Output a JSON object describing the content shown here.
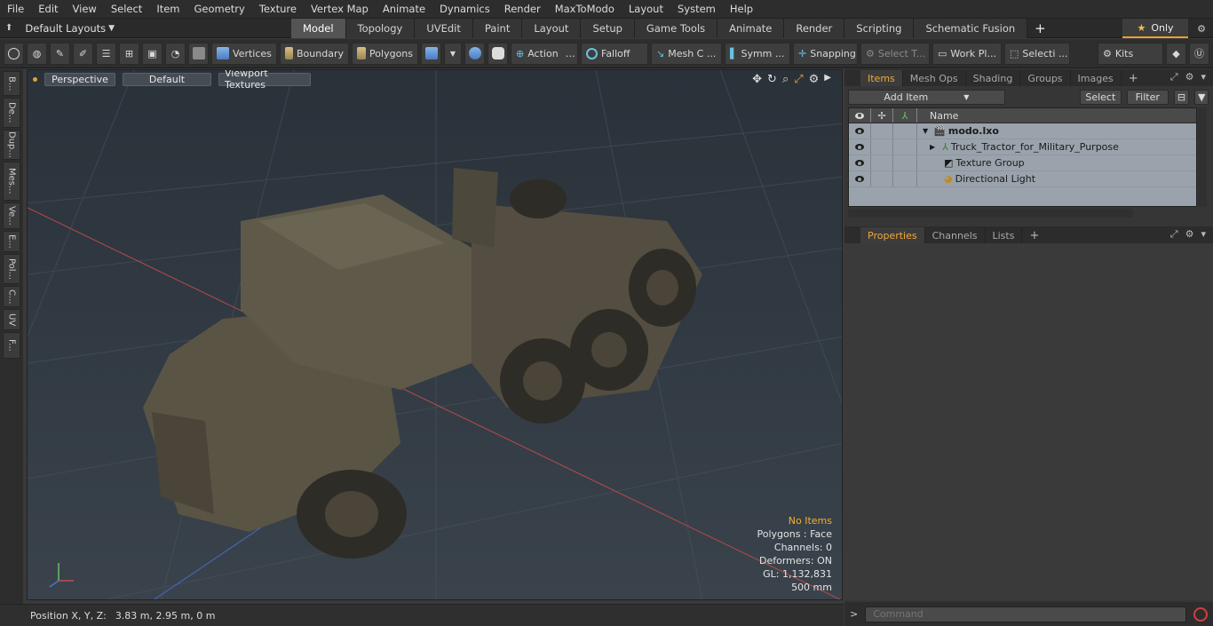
{
  "menu": [
    "File",
    "Edit",
    "View",
    "Select",
    "Item",
    "Geometry",
    "Texture",
    "Vertex Map",
    "Animate",
    "Dynamics",
    "Render",
    "MaxToModo",
    "Layout",
    "System",
    "Help"
  ],
  "layouts_label": "Default Layouts",
  "layout_tabs": [
    "Model",
    "Topology",
    "UVEdit",
    "Paint",
    "Layout",
    "Setup",
    "Game Tools",
    "Animate",
    "Render",
    "Scripting",
    "Schematic Fusion"
  ],
  "active_tab": "Model",
  "only_label": "Only",
  "toolbar": {
    "vertices": "Vertices",
    "boundary": "Boundary",
    "polygons": "Polygons",
    "action": "Action",
    "falloff": "Falloff",
    "meshc": "Mesh C ...",
    "symm": "Symm ...",
    "snapping": "Snapping",
    "selectt": "Select T...",
    "workpl": "Work Pl...",
    "selecti": "Selecti ...",
    "kits": "Kits"
  },
  "left_tabs": [
    "B...",
    "De...",
    "Dup...",
    "Mes...",
    "Ve...",
    "E...",
    "Pol...",
    "C...",
    "UV",
    "F..."
  ],
  "viewport": {
    "perspective": "Perspective",
    "default": "Default",
    "textures": "Viewport Textures",
    "info": {
      "no_items": "No Items",
      "polygons": "Polygons : Face",
      "channels": "Channels: 0",
      "deformers": "Deformers: ON",
      "gl": "GL: 1,132,831",
      "scale": "500 mm"
    }
  },
  "status": {
    "label": "Position X, Y, Z:",
    "value": "3.83 m, 2.95 m, 0 m"
  },
  "items_panel": {
    "tabs": [
      "Items",
      "Mesh Ops",
      "Shading",
      "Groups",
      "Images"
    ],
    "add_item": "Add Item",
    "select": "Select",
    "filter": "Filter",
    "name_header": "Name",
    "rows": [
      {
        "name": "modo.lxo"
      },
      {
        "name": "Truck_Tractor_for_Military_Purpose"
      },
      {
        "name": "Texture Group"
      },
      {
        "name": "Directional Light"
      }
    ]
  },
  "props_panel": {
    "tabs": [
      "Properties",
      "Channels",
      "Lists"
    ]
  },
  "command": {
    "placeholder": "Command"
  },
  "colors": {
    "accent": "#f0a838",
    "viewport_bg": "#323b44",
    "tree_bg": "#9aa3ab"
  }
}
